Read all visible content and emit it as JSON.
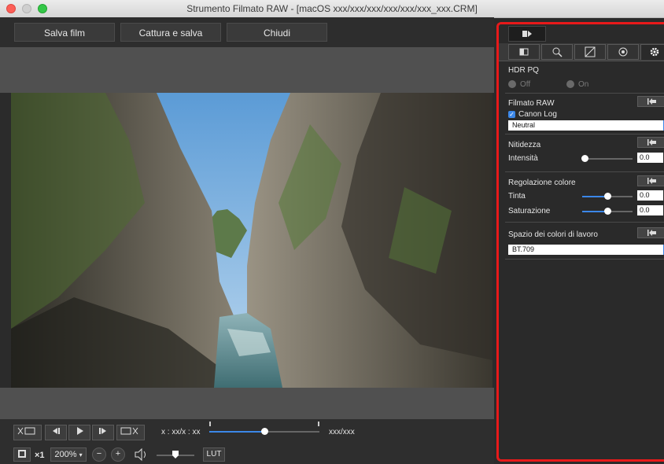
{
  "window": {
    "title": "Strumento Filmato RAW - [macOS xxx/xxx/xxx/xxx/xxx/xxx_xxx.CRM]"
  },
  "toolbar": {
    "save_movie": "Salva film",
    "capture_save": "Cattura e salva",
    "close": "Chiudi"
  },
  "playback": {
    "timecode": "x : xx/x : xx",
    "end_timecode": "xxx/xxx",
    "position": 0.5
  },
  "bottom_bar": {
    "zoom": "200%",
    "speed": "×1",
    "lut": "LUT",
    "volume": 0.5
  },
  "panel": {
    "hdr_pq": {
      "label": "HDR PQ",
      "off": "Off",
      "on": "On"
    },
    "raw_movie": {
      "label": "Filmato RAW",
      "canon_log": "Canon Log",
      "checked": true,
      "preset": "Neutral"
    },
    "sharpness": {
      "label": "Nitidezza",
      "strength_label": "Intensità",
      "strength_value": "0.0"
    },
    "color_adjust": {
      "label": "Regolazione colore",
      "tint_label": "Tinta",
      "tint_value": "0.0",
      "saturation_label": "Saturazione",
      "saturation_value": "0.0"
    },
    "working_color_space": {
      "label": "Spazio dei colori di lavoro",
      "value": "BT.709"
    }
  },
  "icons": [
    "tool-palette-icon",
    "basic-adjust-icon",
    "detail-icon",
    "tone-curve-icon",
    "color-icon",
    "settings-gear-icon",
    "reset-icon",
    "fullscreen-icon",
    "zoom-out-icon",
    "zoom-in-icon",
    "speaker-icon"
  ],
  "colors": {
    "accent": "#3b87e8",
    "highlight_border": "#e8191a"
  }
}
